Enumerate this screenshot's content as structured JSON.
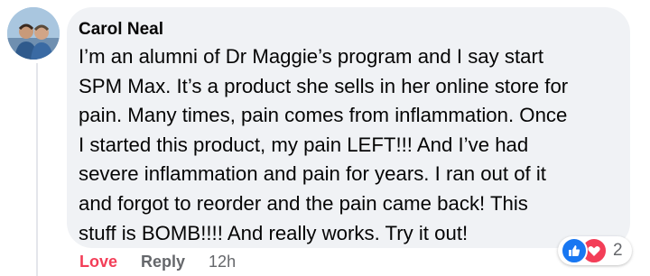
{
  "comment": {
    "author": "Carol Neal",
    "lines": [
      "I’m an alumni of Dr Maggie’s program and I say start",
      "SPM Max. It’s a product she sells in her online store for",
      "pain. Many times, pain comes from inflammation. Once",
      "I started this product, my pain LEFT!!! And I’ve had",
      "severe inflammation and pain for years. I ran out of it",
      "and forgot to reorder and the pain came back! This",
      "stuff is BOMB!!!! And really works. Try it out!"
    ],
    "reactions": {
      "icons": [
        "like-icon",
        "love-icon"
      ],
      "count": "2"
    },
    "actions": {
      "love_label": "Love",
      "reply_label": "Reply",
      "timestamp": "12h"
    }
  },
  "colors": {
    "bubble_bg": "#f0f2f5",
    "love_red": "#f33e58",
    "like_blue": "#1877f2",
    "secondary_text": "#65676b"
  }
}
